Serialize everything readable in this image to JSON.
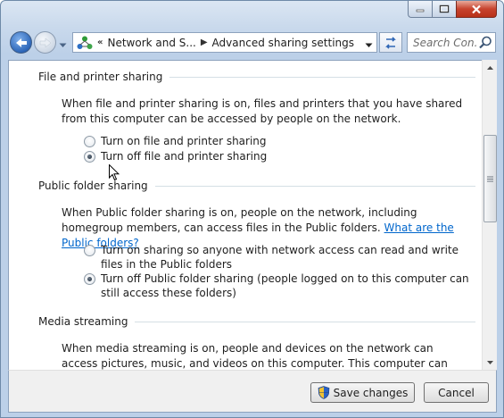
{
  "nav": {
    "breadcrumb": [
      "Network and S...",
      "Advanced sharing settings"
    ],
    "search_placeholder": "Search Con..."
  },
  "sections": {
    "file_printer": {
      "title": "File and printer sharing",
      "description": "When file and printer sharing is on, files and printers that you have shared from this computer can be accessed by people on the network.",
      "options": [
        {
          "label": "Turn on file and printer sharing",
          "checked": false
        },
        {
          "label": "Turn off file and printer sharing",
          "checked": true
        }
      ]
    },
    "public_folder": {
      "title": "Public folder sharing",
      "description": "When Public folder sharing is on, people on the network, including homegroup members, can access files in the Public folders.",
      "link": "What are the Public folders?",
      "options": [
        {
          "label": "Turn on sharing so anyone with network access can read and write files in the Public folders",
          "checked": false
        },
        {
          "label": "Turn off Public folder sharing (people logged on to this computer can still access these folders)",
          "checked": true
        }
      ]
    },
    "media": {
      "title": "Media streaming",
      "description": "When media streaming is on, people and devices on the network can access pictures, music, and videos on this computer. This computer can also find media on the network."
    }
  },
  "footer": {
    "save_label": "Save changes",
    "cancel_label": "Cancel"
  },
  "colors": {
    "link": "#0066cc",
    "close_button": "#c7432e"
  }
}
